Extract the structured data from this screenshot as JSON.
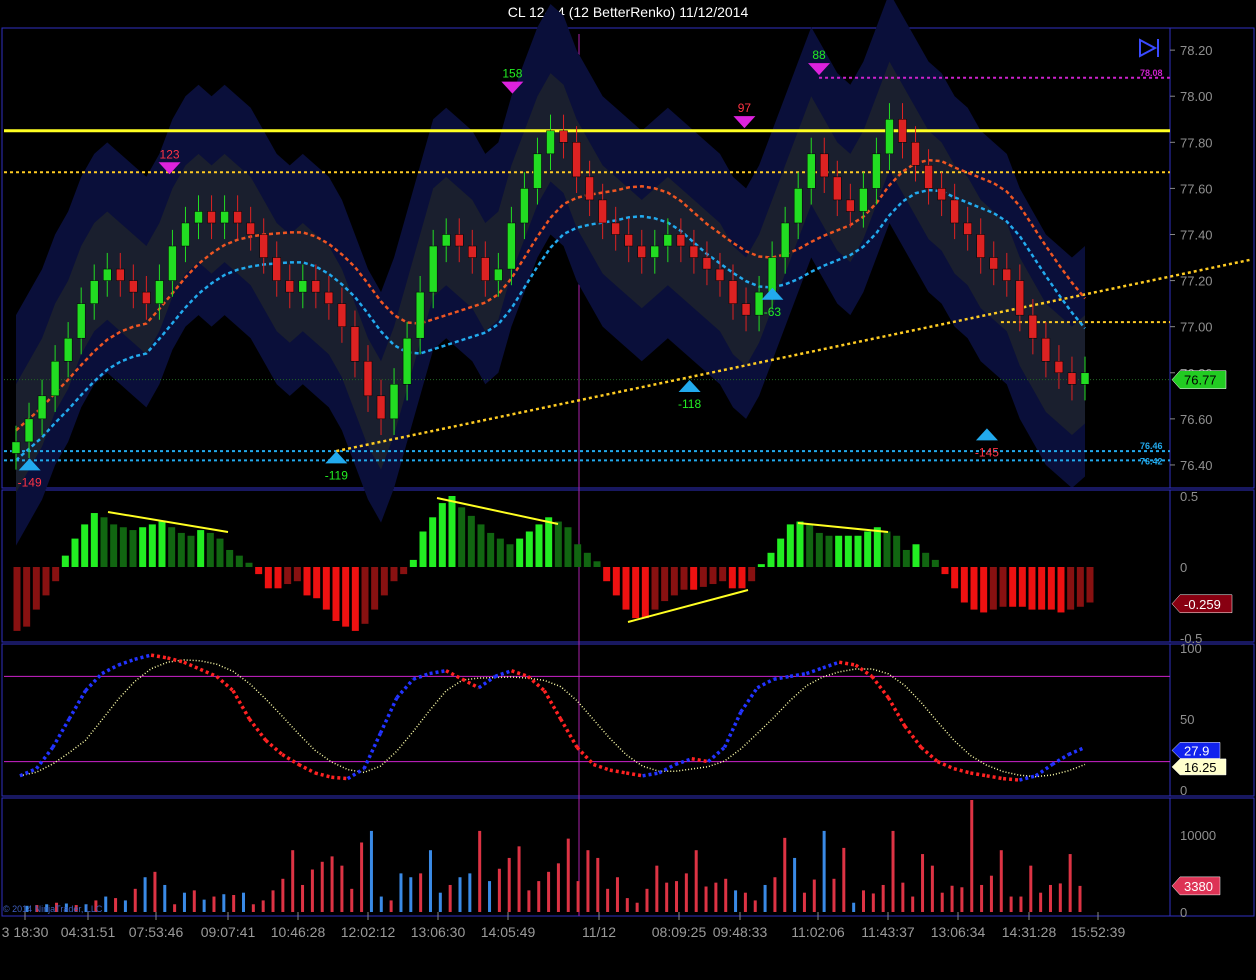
{
  "window": {
    "title": "CL 12-14 (12 BetterRenko)  11/12/2014"
  },
  "colors": {
    "background": "#000000",
    "pane_border": "#3030c0",
    "bull": "#22dd22",
    "bear": "#dd2222",
    "resistance": "#ffff22",
    "trend": "#ffcc22",
    "fast_ma": "#22aaee",
    "slow_ma": "#ee5522",
    "stoch_k": "#2233ff",
    "stoch_k_down": "#ff2222",
    "stoch_d": "#ffffaa",
    "volume_up": "#3a8ae6",
    "volume_down": "#dd3344"
  },
  "chart_data": [
    {
      "type": "candlestick",
      "pane": "price",
      "ylim": [
        76.3,
        78.27
      ],
      "y_ticks": [
        "78.20",
        "78.00",
        "77.80",
        "77.60",
        "77.40",
        "77.20",
        "77.00",
        "76.80",
        "76.60",
        "76.40"
      ],
      "last_price": "76.77",
      "price_tags": [
        "78.08",
        "76.46",
        "76.42"
      ],
      "horizontal_levels": [
        {
          "name": "resistance-line",
          "value": 77.85,
          "style": "solid",
          "color": "#ffff22"
        },
        {
          "name": "resistance-dotted",
          "value": 77.67,
          "style": "dotted",
          "color": "#ffcc22"
        },
        {
          "name": "high-level",
          "value": 78.08,
          "style": "dotted",
          "color": "#cc22cc"
        },
        {
          "name": "low-level-1",
          "value": 76.46,
          "style": "dotted",
          "color": "#22aaee"
        },
        {
          "name": "low-level-2",
          "value": 76.42,
          "style": "dotted",
          "color": "#22aaee"
        },
        {
          "name": "support-short",
          "value": 77.02,
          "style": "dotted",
          "color": "#ffcc22"
        }
      ],
      "trendline": {
        "from": [
          0.285,
          76.46
        ],
        "to": [
          1.0,
          77.29
        ]
      },
      "swing_markers": [
        {
          "label": "-149",
          "x": 0.022,
          "price": 76.42,
          "kind": "low"
        },
        {
          "label": "123",
          "x": 0.142,
          "price": 77.67,
          "kind": "high"
        },
        {
          "label": "-119",
          "x": 0.285,
          "price": 76.45,
          "kind": "low"
        },
        {
          "label": "158",
          "x": 0.436,
          "price": 78.02,
          "kind": "high"
        },
        {
          "label": "-118",
          "x": 0.588,
          "price": 76.76,
          "kind": "low"
        },
        {
          "label": "97",
          "x": 0.635,
          "price": 77.87,
          "kind": "high"
        },
        {
          "label": "-63",
          "x": 0.659,
          "price": 77.16,
          "kind": "low"
        },
        {
          "label": "88",
          "x": 0.699,
          "price": 78.1,
          "kind": "high"
        },
        {
          "label": "-145",
          "x": 0.843,
          "price": 76.55,
          "kind": "low"
        }
      ],
      "series_close": [
        76.5,
        76.6,
        76.7,
        76.85,
        76.95,
        77.1,
        77.2,
        77.25,
        77.2,
        77.15,
        77.1,
        77.2,
        77.35,
        77.45,
        77.5,
        77.45,
        77.5,
        77.45,
        77.4,
        77.3,
        77.2,
        77.15,
        77.2,
        77.15,
        77.1,
        77.0,
        76.85,
        76.7,
        76.6,
        76.75,
        76.95,
        77.15,
        77.35,
        77.4,
        77.35,
        77.3,
        77.2,
        77.25,
        77.45,
        77.6,
        77.75,
        77.85,
        77.8,
        77.65,
        77.55,
        77.45,
        77.4,
        77.35,
        77.3,
        77.35,
        77.4,
        77.35,
        77.3,
        77.25,
        77.2,
        77.1,
        77.05,
        77.15,
        77.3,
        77.45,
        77.6,
        77.75,
        77.65,
        77.55,
        77.5,
        77.6,
        77.75,
        77.9,
        77.8,
        77.7,
        77.6,
        77.55,
        77.45,
        77.4,
        77.3,
        77.25,
        77.2,
        77.05,
        76.95,
        76.85,
        76.8,
        76.75,
        76.8
      ],
      "volume_ylim": [
        0,
        14500
      ],
      "volume_ticks": [
        "10000",
        "0"
      ],
      "volume_last": "3380",
      "x_labels": [
        "3 18:30",
        "04:31:51",
        "07:53:46",
        "09:07:41",
        "10:46:28",
        "12:02:12",
        "13:06:30",
        "14:05:49",
        "11/12",
        "08:09:25",
        "09:48:33",
        "11:02:06",
        "11:43:37",
        "13:06:34",
        "14:31:28",
        "15:52:39"
      ]
    },
    {
      "type": "bar",
      "pane": "oscillator",
      "ylim": [
        -0.5,
        0.5
      ],
      "y_ticks": [
        "0.5",
        "0",
        "-0.5"
      ],
      "last_value": "-0.259"
    },
    {
      "type": "line",
      "pane": "stochastic",
      "ylim": [
        0,
        100
      ],
      "y_ticks": [
        "100",
        "50",
        "0"
      ],
      "levels": [
        80,
        20
      ],
      "k_last": "27.9",
      "d_last": "16.25"
    }
  ],
  "copyright": "© 2014 NinjaTrader, LLC"
}
